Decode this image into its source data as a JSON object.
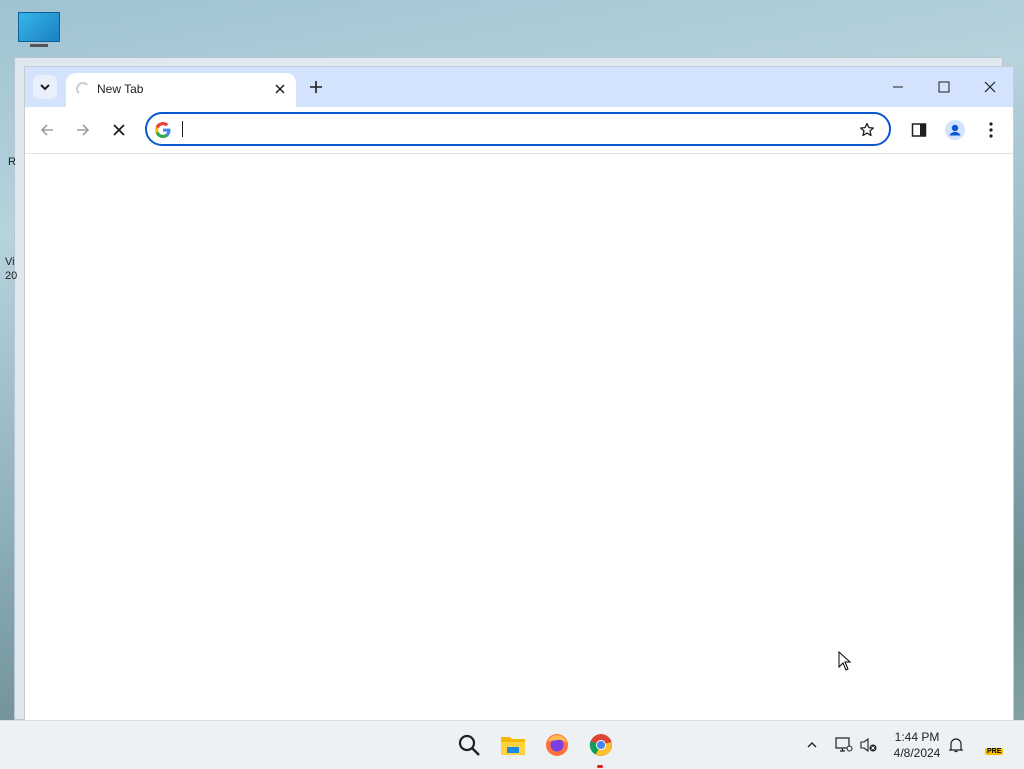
{
  "browser": {
    "tab": {
      "title": "New Tab"
    },
    "omnibox": {
      "value": "",
      "placeholder": ""
    },
    "colors": {
      "tabstrip": "#d3e3fd",
      "focus_ring": "#0b57d0"
    }
  },
  "desktop": {
    "partial_texts": [
      "R",
      "Vi",
      "20"
    ]
  },
  "taskbar": {
    "icons": [
      "search-icon",
      "file-explorer-icon",
      "firefox-icon",
      "chrome-icon"
    ],
    "tray": [
      "chevron-up-icon",
      "network-icon",
      "volume-muted-icon",
      "notification-bell-icon"
    ],
    "time": "1:44 PM",
    "date": "4/8/2024",
    "badge": "PRE"
  }
}
